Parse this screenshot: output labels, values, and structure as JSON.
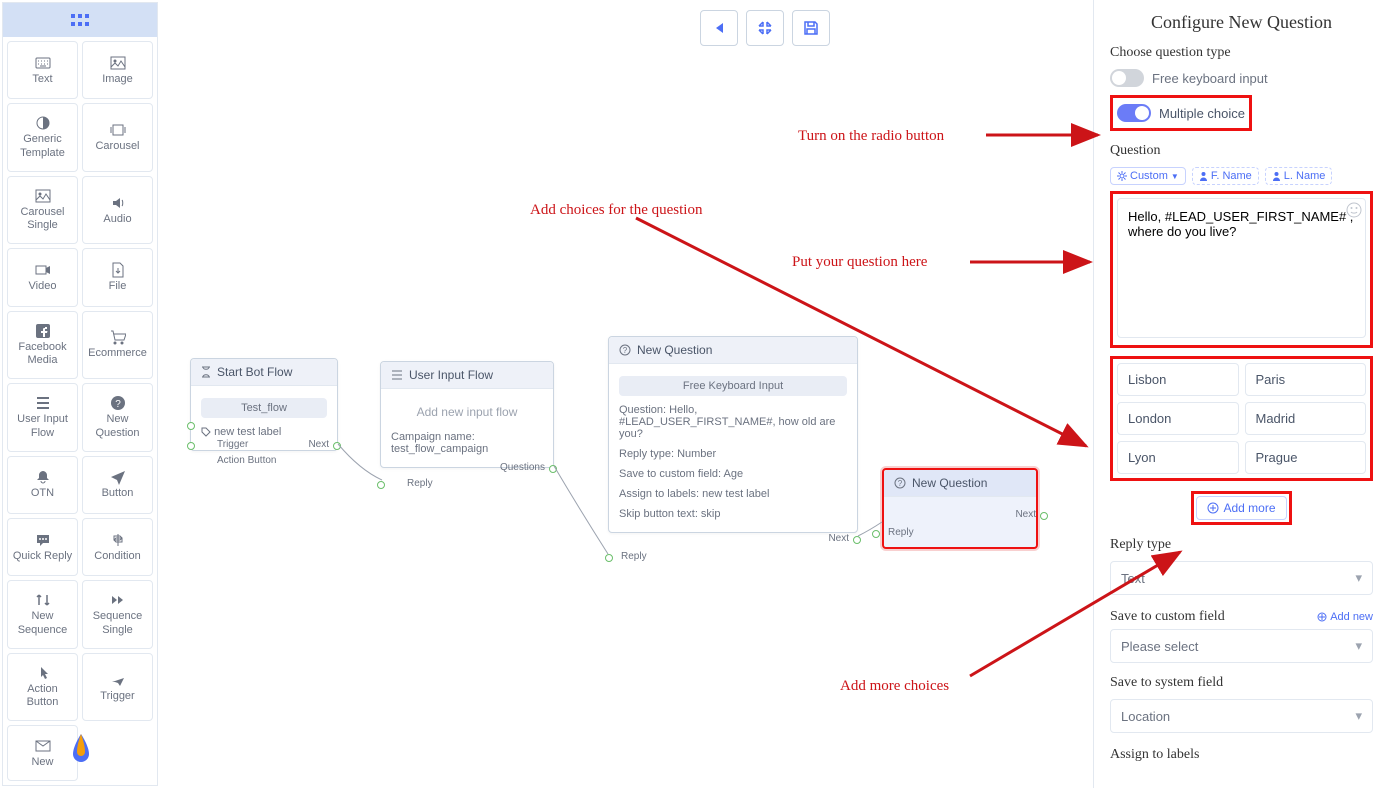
{
  "palette": {
    "items": [
      {
        "label": "Text",
        "icon": "keyboard"
      },
      {
        "label": "Image",
        "icon": "image"
      },
      {
        "label": "Generic Template",
        "icon": "contrast"
      },
      {
        "label": "Carousel",
        "icon": "carousel"
      },
      {
        "label": "Carousel Single",
        "icon": "image"
      },
      {
        "label": "Audio",
        "icon": "audio"
      },
      {
        "label": "Video",
        "icon": "video"
      },
      {
        "label": "File",
        "icon": "file"
      },
      {
        "label": "Facebook Media",
        "icon": "facebook"
      },
      {
        "label": "Ecommerce",
        "icon": "cart"
      },
      {
        "label": "User Input Flow",
        "icon": "list"
      },
      {
        "label": "New Question",
        "icon": "question"
      },
      {
        "label": "OTN",
        "icon": "bell"
      },
      {
        "label": "Button",
        "icon": "send"
      },
      {
        "label": "Quick Reply",
        "icon": "chat"
      },
      {
        "label": "Condition",
        "icon": "signpost"
      },
      {
        "label": "New Sequence",
        "icon": "sort"
      },
      {
        "label": "Sequence Single",
        "icon": "fast"
      },
      {
        "label": "Action Button",
        "icon": "pointer"
      },
      {
        "label": "Trigger",
        "icon": "plane"
      },
      {
        "label": "New",
        "icon": "mail"
      }
    ]
  },
  "toolbar": {
    "back": "back",
    "compress": "compress",
    "save": "save"
  },
  "nodes": {
    "start": {
      "title": "Start Bot Flow",
      "badge": "Test_flow",
      "label_text": "new test label",
      "port_trigger": "Trigger",
      "port_action": "Action Button",
      "port_next": "Next"
    },
    "userinput": {
      "title": "User Input Flow",
      "subtitle": "Add new input flow",
      "campaign": "Campaign name: test_flow_campaign",
      "port_questions": "Questions",
      "port_reply": "Reply"
    },
    "q1": {
      "title": "New Question",
      "badge": "Free Keyboard Input",
      "question": "Question: Hello, #LEAD_USER_FIRST_NAME#, how old are you?",
      "reply_type": "Reply type: Number",
      "save_field": "Save to custom field: Age",
      "assign": "Assign to labels: new test label",
      "skip": "Skip button text: skip",
      "port_next": "Next",
      "port_reply": "Reply"
    },
    "q2": {
      "title": "New Question",
      "port_next": "Next",
      "port_reply": "Reply"
    }
  },
  "right": {
    "title": "Configure New Question",
    "choose_type": "Choose question type",
    "toggle_free": "Free keyboard input",
    "toggle_multi": "Multiple choice",
    "question_label": "Question",
    "chip_custom": "Custom",
    "chip_fname": "F. Name",
    "chip_lname": "L. Name",
    "question_text": "Hello, #LEAD_USER_FIRST_NAME# , where do you live?",
    "choices": [
      "Lisbon",
      "Paris",
      "London",
      "Madrid",
      "Lyon",
      "Prague"
    ],
    "add_more": "Add more",
    "reply_type_label": "Reply type",
    "reply_type_value": "Text",
    "save_custom_label": "Save to custom field",
    "add_new": "Add new",
    "save_custom_value": "Please select",
    "save_system_label": "Save to system field",
    "save_system_value": "Location",
    "assign_labels": "Assign to labels"
  },
  "anno": {
    "turn_on": "Turn on the radio button",
    "add_choices": "Add choices for the question",
    "put_question": "Put your question here",
    "add_more_choices": "Add more choices"
  }
}
